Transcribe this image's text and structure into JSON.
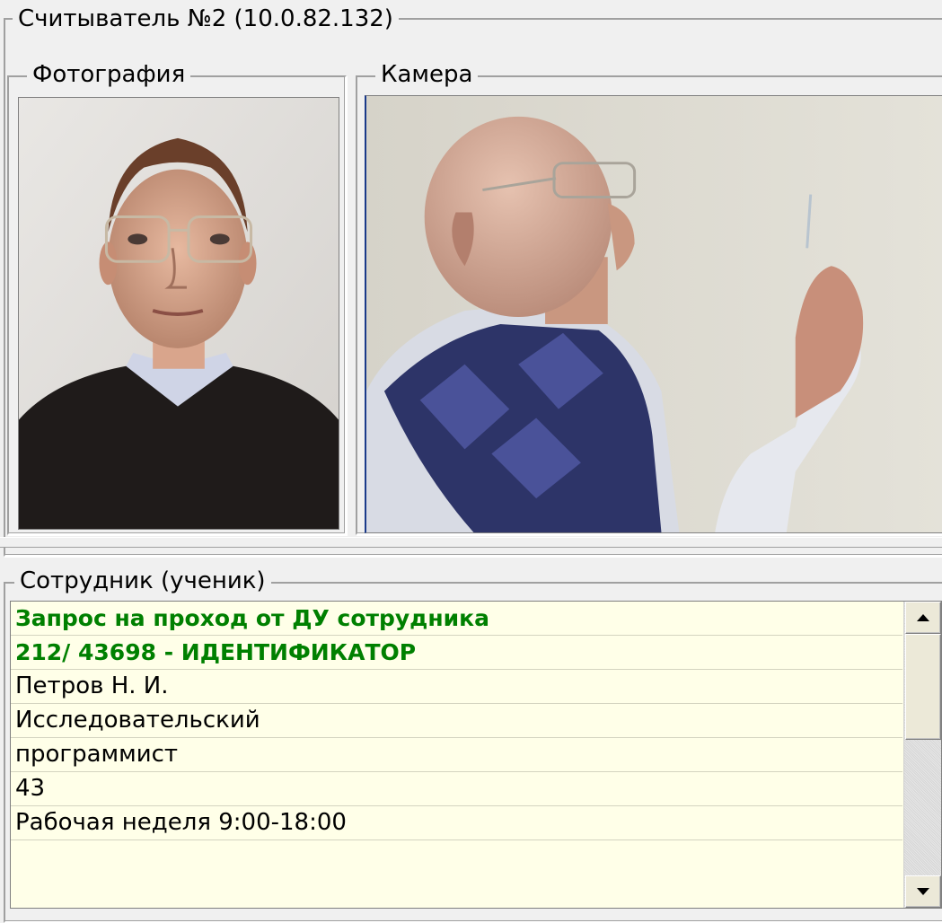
{
  "reader_group": {
    "title": "Считыватель №2 (10.0.82.132)"
  },
  "photo_group": {
    "title": "Фотография"
  },
  "camera_group": {
    "title": "Камера"
  },
  "employee_group": {
    "title": "Сотрудник (ученик)"
  },
  "employee_rows": [
    {
      "text": "Запрос на проход от ДУ сотрудника",
      "highlight": true
    },
    {
      "text": "212/ 43698 - ИДЕНТИФИКАТОР",
      "highlight": true
    },
    {
      "text": "Петров Н. И.",
      "highlight": false
    },
    {
      "text": "Исследовательский",
      "highlight": false
    },
    {
      "text": "программист",
      "highlight": false
    },
    {
      "text": "43",
      "highlight": false
    },
    {
      "text": "Рабочая неделя 9:00-18:00",
      "highlight": false
    }
  ],
  "colors": {
    "highlight_text": "#008000",
    "list_background": "#ffffe8",
    "window_background": "#f0f0f0"
  },
  "icons": {
    "scroll_up": "arrow-up-icon",
    "scroll_down": "arrow-down-icon"
  }
}
